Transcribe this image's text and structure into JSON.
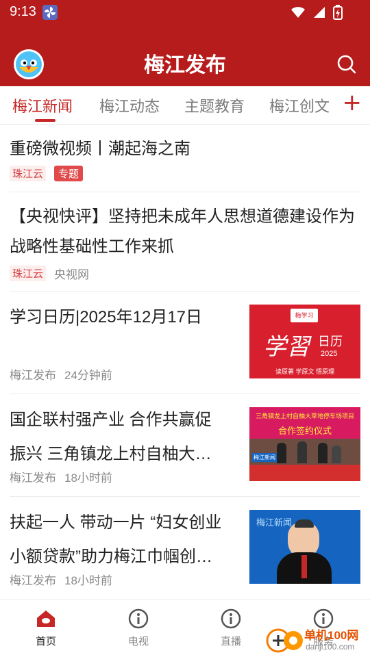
{
  "status_bar": {
    "time": "9:13"
  },
  "header": {
    "title": "梅江发布"
  },
  "tabs": [
    {
      "label": "梅江新闻",
      "active": true
    },
    {
      "label": "梅江动态",
      "active": false
    },
    {
      "label": "主题教育",
      "active": false
    },
    {
      "label": "梅江创文",
      "active": false
    }
  ],
  "tab_add_label": "+",
  "news": [
    {
      "title": "重磅微视频丨潮起海之南",
      "tags": [
        "珠江云",
        "专题"
      ],
      "source": "",
      "time": ""
    },
    {
      "title": "【央视快评】坚持把未成年人思想道德建设作为战略性基础性工作来抓",
      "tags": [
        "珠江云"
      ],
      "source": "央视网",
      "time": ""
    },
    {
      "title": "学习日历|2025年12月17日",
      "source": "梅江发布",
      "time": "24分钟前",
      "thumb": {
        "logo": "梅学习",
        "big1": "学習",
        "big2": "日历",
        "year": "2025",
        "footer": "读原著  学原文  悟原理"
      }
    },
    {
      "title_line1": "国企联村强产业 合作共赢促",
      "title_line2": "振兴 三角镇龙上村自柚大…",
      "source": "梅江发布",
      "time": "18小时前",
      "thumb": {
        "banner": "三角镇龙上村自柚大草地停车场项目",
        "sub": "合作签约仪式",
        "sign": "梅江新闻"
      }
    },
    {
      "title_line1": "扶起一人 带动一片 “妇女创业",
      "title_line2": "小额贷款”助力梅江巾帼创…",
      "source": "梅江发布",
      "time": "18小时前",
      "thumb": {
        "logo": "梅江新闻"
      }
    }
  ],
  "bottom_nav": [
    {
      "label": "首页",
      "active": true
    },
    {
      "label": "电视",
      "active": false
    },
    {
      "label": "直播",
      "active": false
    },
    {
      "label": "服务",
      "active": false
    }
  ],
  "watermark": {
    "text1": "单机100网",
    "text2": "danji100.com"
  },
  "colors": {
    "brand": "#b71c1c",
    "accent": "#c62828"
  }
}
